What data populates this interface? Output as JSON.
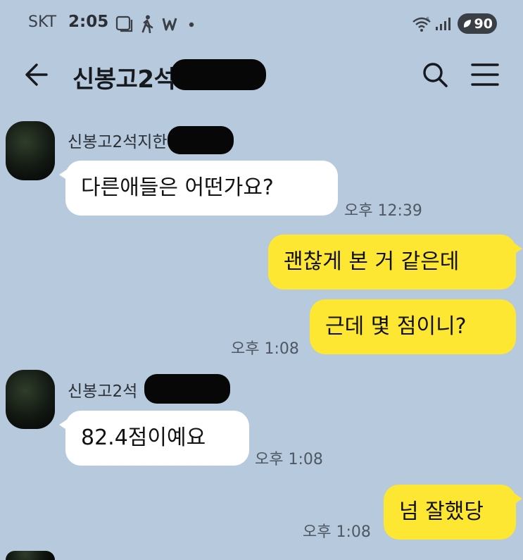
{
  "status_bar": {
    "carrier": "SKT",
    "time": "2:05",
    "battery": "90"
  },
  "header": {
    "title": "신봉고2석"
  },
  "messages": [
    {
      "sender": "신봉고2석지한폰",
      "text": "다른애들은 어떤가요?",
      "time": "오후 12:39"
    },
    {
      "text": "괜찮게 본 거 같은데"
    },
    {
      "text": "근데 몇 점이니?",
      "time": "오후 1:08"
    },
    {
      "sender": "신봉고2석",
      "text": "82.4점이예요",
      "time": "오후 1:08"
    },
    {
      "text": "넘 잘했당",
      "time": "오후 1:08"
    }
  ],
  "colors": {
    "background": "#b7c9dc",
    "outgoing_bubble": "#fde732",
    "incoming_bubble": "#ffffff"
  },
  "icons": [
    "gallery-icon",
    "walking-icon",
    "w-app-icon",
    "notification-dot-icon",
    "wifi-icon",
    "signal-icon",
    "battery-icon",
    "back-arrow-icon",
    "search-icon",
    "menu-icon"
  ]
}
